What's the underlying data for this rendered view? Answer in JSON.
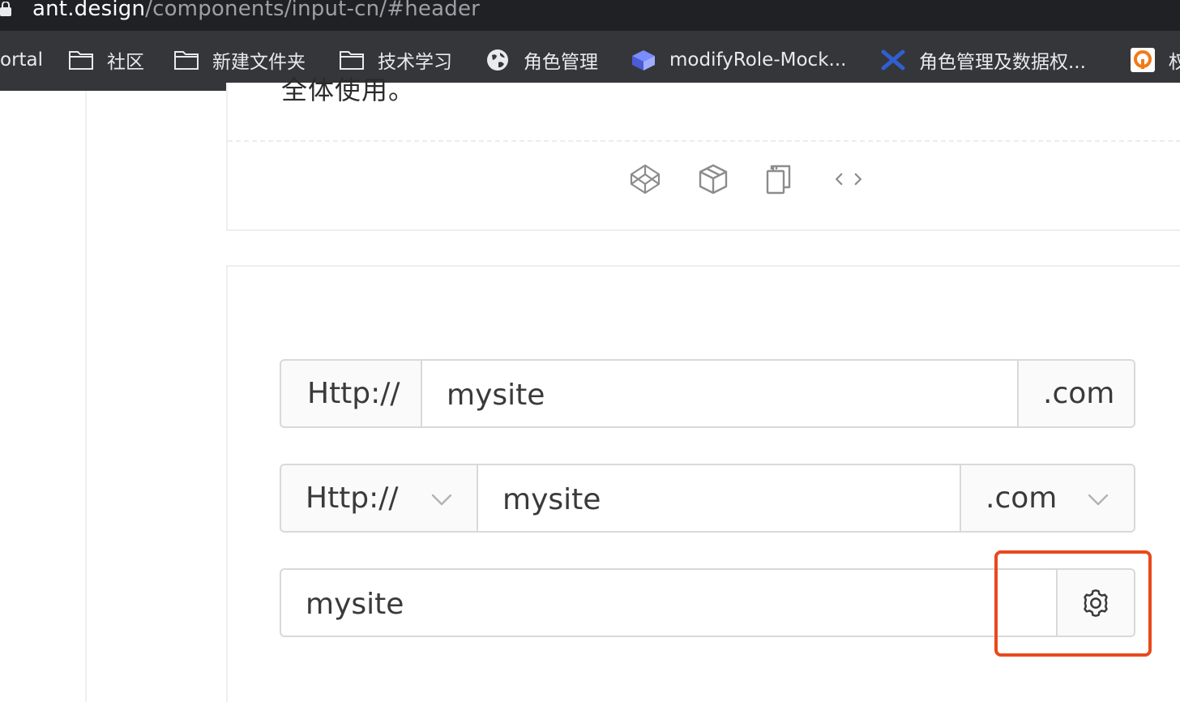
{
  "browser": {
    "url_host": "ant.design",
    "url_path": "/components/input-cn/#header",
    "bookmarks": [
      {
        "label": "ortal",
        "icon": "none"
      },
      {
        "label": "社区",
        "icon": "folder-icon"
      },
      {
        "label": "新建文件夹",
        "icon": "folder-icon"
      },
      {
        "label": "技术学习",
        "icon": "folder-icon"
      },
      {
        "label": "角色管理",
        "icon": "globe-icon"
      },
      {
        "label": "modifyRole-Mock...",
        "icon": "cube-icon"
      },
      {
        "label": "角色管理及数据权...",
        "icon": "app-icon"
      },
      {
        "label": "权",
        "icon": "orange-app-icon"
      }
    ]
  },
  "demo_card": {
    "cut_text": "全体使用。",
    "toolbar": [
      "codepen-icon",
      "codesandbox-icon",
      "copy-icon",
      "code-expand-icon"
    ]
  },
  "groups": {
    "g1": {
      "prefix": "Http://",
      "value": "mysite",
      "suffix": ".com"
    },
    "g2": {
      "prefix": "Http://",
      "value": "mysite",
      "suffix": ".com"
    },
    "g3": {
      "value": "mysite",
      "addon_icon": "setting-icon"
    }
  },
  "colors": {
    "highlight": "#e8491d",
    "border": "#d9d9d9",
    "addon_bg": "#fafafa"
  }
}
